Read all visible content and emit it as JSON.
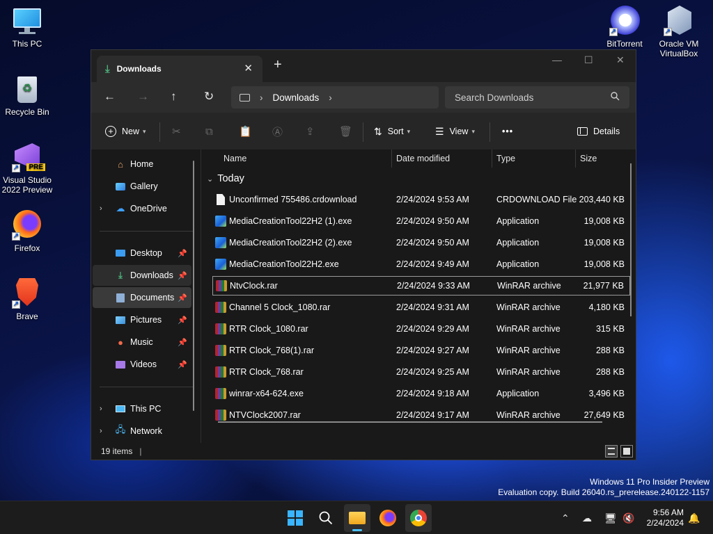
{
  "desktop": {
    "icons": [
      {
        "label": "This PC",
        "icon": "this-pc-icon"
      },
      {
        "label": "Recycle Bin",
        "icon": "recycle-bin-icon"
      },
      {
        "label": "Visual Studio 2022 Preview",
        "icon": "visual-studio-icon",
        "badge": "PRE"
      },
      {
        "label": "Firefox",
        "icon": "firefox-icon"
      },
      {
        "label": "Brave",
        "icon": "brave-icon"
      },
      {
        "label": "BitTorrent",
        "icon": "bittorrent-icon"
      },
      {
        "label": "Oracle VM VirtualBox",
        "icon": "virtualbox-icon"
      }
    ]
  },
  "window": {
    "tab_title": "Downloads",
    "address": {
      "segments": [
        "Downloads"
      ]
    },
    "search": {
      "placeholder": "Search Downloads"
    },
    "toolbar": {
      "new_label": "New",
      "sort_label": "Sort",
      "view_label": "View",
      "details_label": "Details",
      "more_label": "•••"
    },
    "sidebar": {
      "items": [
        {
          "label": "Home",
          "icon": "home-icon"
        },
        {
          "label": "Gallery",
          "icon": "gallery-icon"
        },
        {
          "label": "OneDrive",
          "icon": "onedrive-icon"
        },
        {
          "label": "Desktop",
          "icon": "desktop-folder-icon"
        },
        {
          "label": "Downloads",
          "icon": "downloads-folder-icon"
        },
        {
          "label": "Documents",
          "icon": "documents-folder-icon"
        },
        {
          "label": "Pictures",
          "icon": "pictures-folder-icon"
        },
        {
          "label": "Music",
          "icon": "music-folder-icon"
        },
        {
          "label": "Videos",
          "icon": "videos-folder-icon"
        },
        {
          "label": "This PC",
          "icon": "this-pc-icon"
        },
        {
          "label": "Network",
          "icon": "network-icon"
        }
      ]
    },
    "columns": {
      "name": "Name",
      "date": "Date modified",
      "type": "Type",
      "size": "Size"
    },
    "group_label": "Today",
    "files": [
      {
        "name": "Unconfirmed 755486.crdownload",
        "date": "2/24/2024 9:53 AM",
        "type": "CRDOWNLOAD File",
        "size": "203,440 KB",
        "icon": "document-icon"
      },
      {
        "name": "MediaCreationTool22H2 (1).exe",
        "date": "2/24/2024 9:50 AM",
        "type": "Application",
        "size": "19,008 KB",
        "icon": "exe-icon"
      },
      {
        "name": "MediaCreationTool22H2 (2).exe",
        "date": "2/24/2024 9:50 AM",
        "type": "Application",
        "size": "19,008 KB",
        "icon": "exe-icon"
      },
      {
        "name": "MediaCreationTool22H2.exe",
        "date": "2/24/2024 9:49 AM",
        "type": "Application",
        "size": "19,008 KB",
        "icon": "exe-icon"
      },
      {
        "name": "NtvClock.rar",
        "date": "2/24/2024 9:33 AM",
        "type": "WinRAR archive",
        "size": "21,977 KB",
        "icon": "rar-icon"
      },
      {
        "name": "Channel 5 Clock_1080.rar",
        "date": "2/24/2024 9:31 AM",
        "type": "WinRAR archive",
        "size": "4,180 KB",
        "icon": "rar-icon"
      },
      {
        "name": "RTR Clock_1080.rar",
        "date": "2/24/2024 9:29 AM",
        "type": "WinRAR archive",
        "size": "315 KB",
        "icon": "rar-icon"
      },
      {
        "name": "RTR Clock_768(1).rar",
        "date": "2/24/2024 9:27 AM",
        "type": "WinRAR archive",
        "size": "288 KB",
        "icon": "rar-icon"
      },
      {
        "name": "RTR Clock_768.rar",
        "date": "2/24/2024 9:25 AM",
        "type": "WinRAR archive",
        "size": "288 KB",
        "icon": "rar-icon"
      },
      {
        "name": "winrar-x64-624.exe",
        "date": "2/24/2024 9:18 AM",
        "type": "Application",
        "size": "3,496 KB",
        "icon": "rar-icon"
      },
      {
        "name": "NTVClock2007.rar",
        "date": "2/24/2024 9:17 AM",
        "type": "WinRAR archive",
        "size": "27,649 KB",
        "icon": "rar-icon"
      }
    ],
    "status": {
      "items_count": "19 items"
    }
  },
  "watermark": {
    "line1": "Windows 11 Pro Insider Preview",
    "line2": "Evaluation copy. Build 26040.rs_prerelease.240122-1157"
  },
  "taskbar": {
    "apps": [
      "start-icon",
      "search-icon",
      "file-explorer-icon",
      "firefox-icon",
      "chrome-icon"
    ],
    "clock": {
      "time": "9:56 AM",
      "date": "2/24/2024"
    }
  },
  "colors": {
    "accent": "#4cc2ff",
    "window_bg": "#191919",
    "taskbar_bg": "#1c1c1c"
  }
}
